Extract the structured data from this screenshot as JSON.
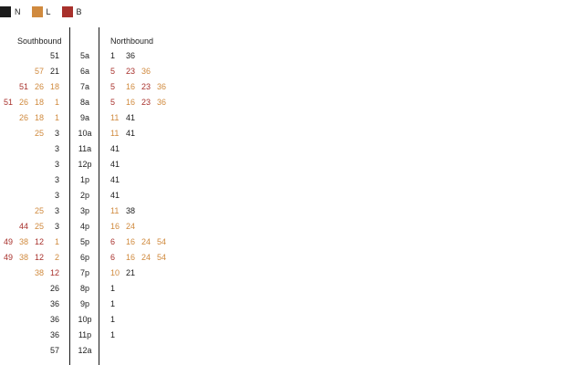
{
  "legend": [
    {
      "key": "N",
      "label": "N",
      "color": "#1c1c1c"
    },
    {
      "key": "L",
      "label": "L",
      "color": "#d08a3e"
    },
    {
      "key": "B",
      "label": "B",
      "color": "#a8312c"
    }
  ],
  "headers": {
    "southbound": "Southbound",
    "northbound": "Northbound"
  },
  "rows": [
    {
      "time": "5a",
      "south": [
        {
          "v": "51",
          "c": "N"
        }
      ],
      "north": [
        {
          "v": "1",
          "c": "N"
        },
        {
          "v": "36",
          "c": "N"
        }
      ]
    },
    {
      "time": "6a",
      "south": [
        {
          "v": "57",
          "c": "L"
        },
        {
          "v": "21",
          "c": "N"
        }
      ],
      "north": [
        {
          "v": "5",
          "c": "B"
        },
        {
          "v": "23",
          "c": "B"
        },
        {
          "v": "36",
          "c": "L"
        }
      ]
    },
    {
      "time": "7a",
      "south": [
        {
          "v": "51",
          "c": "B"
        },
        {
          "v": "26",
          "c": "L"
        },
        {
          "v": "18",
          "c": "L"
        }
      ],
      "north": [
        {
          "v": "5",
          "c": "B"
        },
        {
          "v": "16",
          "c": "L"
        },
        {
          "v": "23",
          "c": "B"
        },
        {
          "v": "36",
          "c": "L"
        }
      ]
    },
    {
      "time": "8a",
      "south": [
        {
          "v": "51",
          "c": "B"
        },
        {
          "v": "26",
          "c": "L"
        },
        {
          "v": "18",
          "c": "L"
        },
        {
          "v": "1",
          "c": "L"
        }
      ],
      "north": [
        {
          "v": "5",
          "c": "B"
        },
        {
          "v": "16",
          "c": "L"
        },
        {
          "v": "23",
          "c": "B"
        },
        {
          "v": "36",
          "c": "L"
        }
      ]
    },
    {
      "time": "9a",
      "south": [
        {
          "v": "26",
          "c": "L"
        },
        {
          "v": "18",
          "c": "L"
        },
        {
          "v": "1",
          "c": "L"
        }
      ],
      "north": [
        {
          "v": "11",
          "c": "L"
        },
        {
          "v": "41",
          "c": "N"
        }
      ]
    },
    {
      "time": "10a",
      "south": [
        {
          "v": "25",
          "c": "L"
        },
        {
          "v": "3",
          "c": "N"
        }
      ],
      "north": [
        {
          "v": "11",
          "c": "L"
        },
        {
          "v": "41",
          "c": "N"
        }
      ]
    },
    {
      "time": "11a",
      "south": [
        {
          "v": "3",
          "c": "N"
        }
      ],
      "north": [
        {
          "v": "41",
          "c": "N"
        }
      ]
    },
    {
      "time": "12p",
      "south": [
        {
          "v": "3",
          "c": "N"
        }
      ],
      "north": [
        {
          "v": "41",
          "c": "N"
        }
      ]
    },
    {
      "time": "1p",
      "south": [
        {
          "v": "3",
          "c": "N"
        }
      ],
      "north": [
        {
          "v": "41",
          "c": "N"
        }
      ]
    },
    {
      "time": "2p",
      "south": [
        {
          "v": "3",
          "c": "N"
        }
      ],
      "north": [
        {
          "v": "41",
          "c": "N"
        }
      ]
    },
    {
      "time": "3p",
      "south": [
        {
          "v": "25",
          "c": "L"
        },
        {
          "v": "3",
          "c": "N"
        }
      ],
      "north": [
        {
          "v": "11",
          "c": "L"
        },
        {
          "v": "38",
          "c": "N"
        }
      ]
    },
    {
      "time": "4p",
      "south": [
        {
          "v": "44",
          "c": "B"
        },
        {
          "v": "25",
          "c": "L"
        },
        {
          "v": "3",
          "c": "N"
        }
      ],
      "north": [
        {
          "v": "16",
          "c": "L"
        },
        {
          "v": "24",
          "c": "L"
        }
      ]
    },
    {
      "time": "5p",
      "south": [
        {
          "v": "49",
          "c": "B"
        },
        {
          "v": "38",
          "c": "L"
        },
        {
          "v": "12",
          "c": "B"
        },
        {
          "v": "1",
          "c": "L"
        }
      ],
      "north": [
        {
          "v": "6",
          "c": "B"
        },
        {
          "v": "16",
          "c": "L"
        },
        {
          "v": "24",
          "c": "L"
        },
        {
          "v": "54",
          "c": "L"
        }
      ]
    },
    {
      "time": "6p",
      "south": [
        {
          "v": "49",
          "c": "B"
        },
        {
          "v": "38",
          "c": "L"
        },
        {
          "v": "12",
          "c": "B"
        },
        {
          "v": "2",
          "c": "L"
        }
      ],
      "north": [
        {
          "v": "6",
          "c": "B"
        },
        {
          "v": "16",
          "c": "L"
        },
        {
          "v": "24",
          "c": "L"
        },
        {
          "v": "54",
          "c": "L"
        }
      ]
    },
    {
      "time": "7p",
      "south": [
        {
          "v": "38",
          "c": "L"
        },
        {
          "v": "12",
          "c": "B"
        }
      ],
      "north": [
        {
          "v": "10",
          "c": "L"
        },
        {
          "v": "21",
          "c": "N"
        }
      ]
    },
    {
      "time": "8p",
      "south": [
        {
          "v": "26",
          "c": "N"
        }
      ],
      "north": [
        {
          "v": "1",
          "c": "N"
        }
      ]
    },
    {
      "time": "9p",
      "south": [
        {
          "v": "36",
          "c": "N"
        }
      ],
      "north": [
        {
          "v": "1",
          "c": "N"
        }
      ]
    },
    {
      "time": "10p",
      "south": [
        {
          "v": "36",
          "c": "N"
        }
      ],
      "north": [
        {
          "v": "1",
          "c": "N"
        }
      ]
    },
    {
      "time": "11p",
      "south": [
        {
          "v": "36",
          "c": "N"
        }
      ],
      "north": [
        {
          "v": "1",
          "c": "N"
        }
      ]
    },
    {
      "time": "12a",
      "south": [
        {
          "v": "57",
          "c": "N"
        }
      ],
      "north": []
    }
  ]
}
